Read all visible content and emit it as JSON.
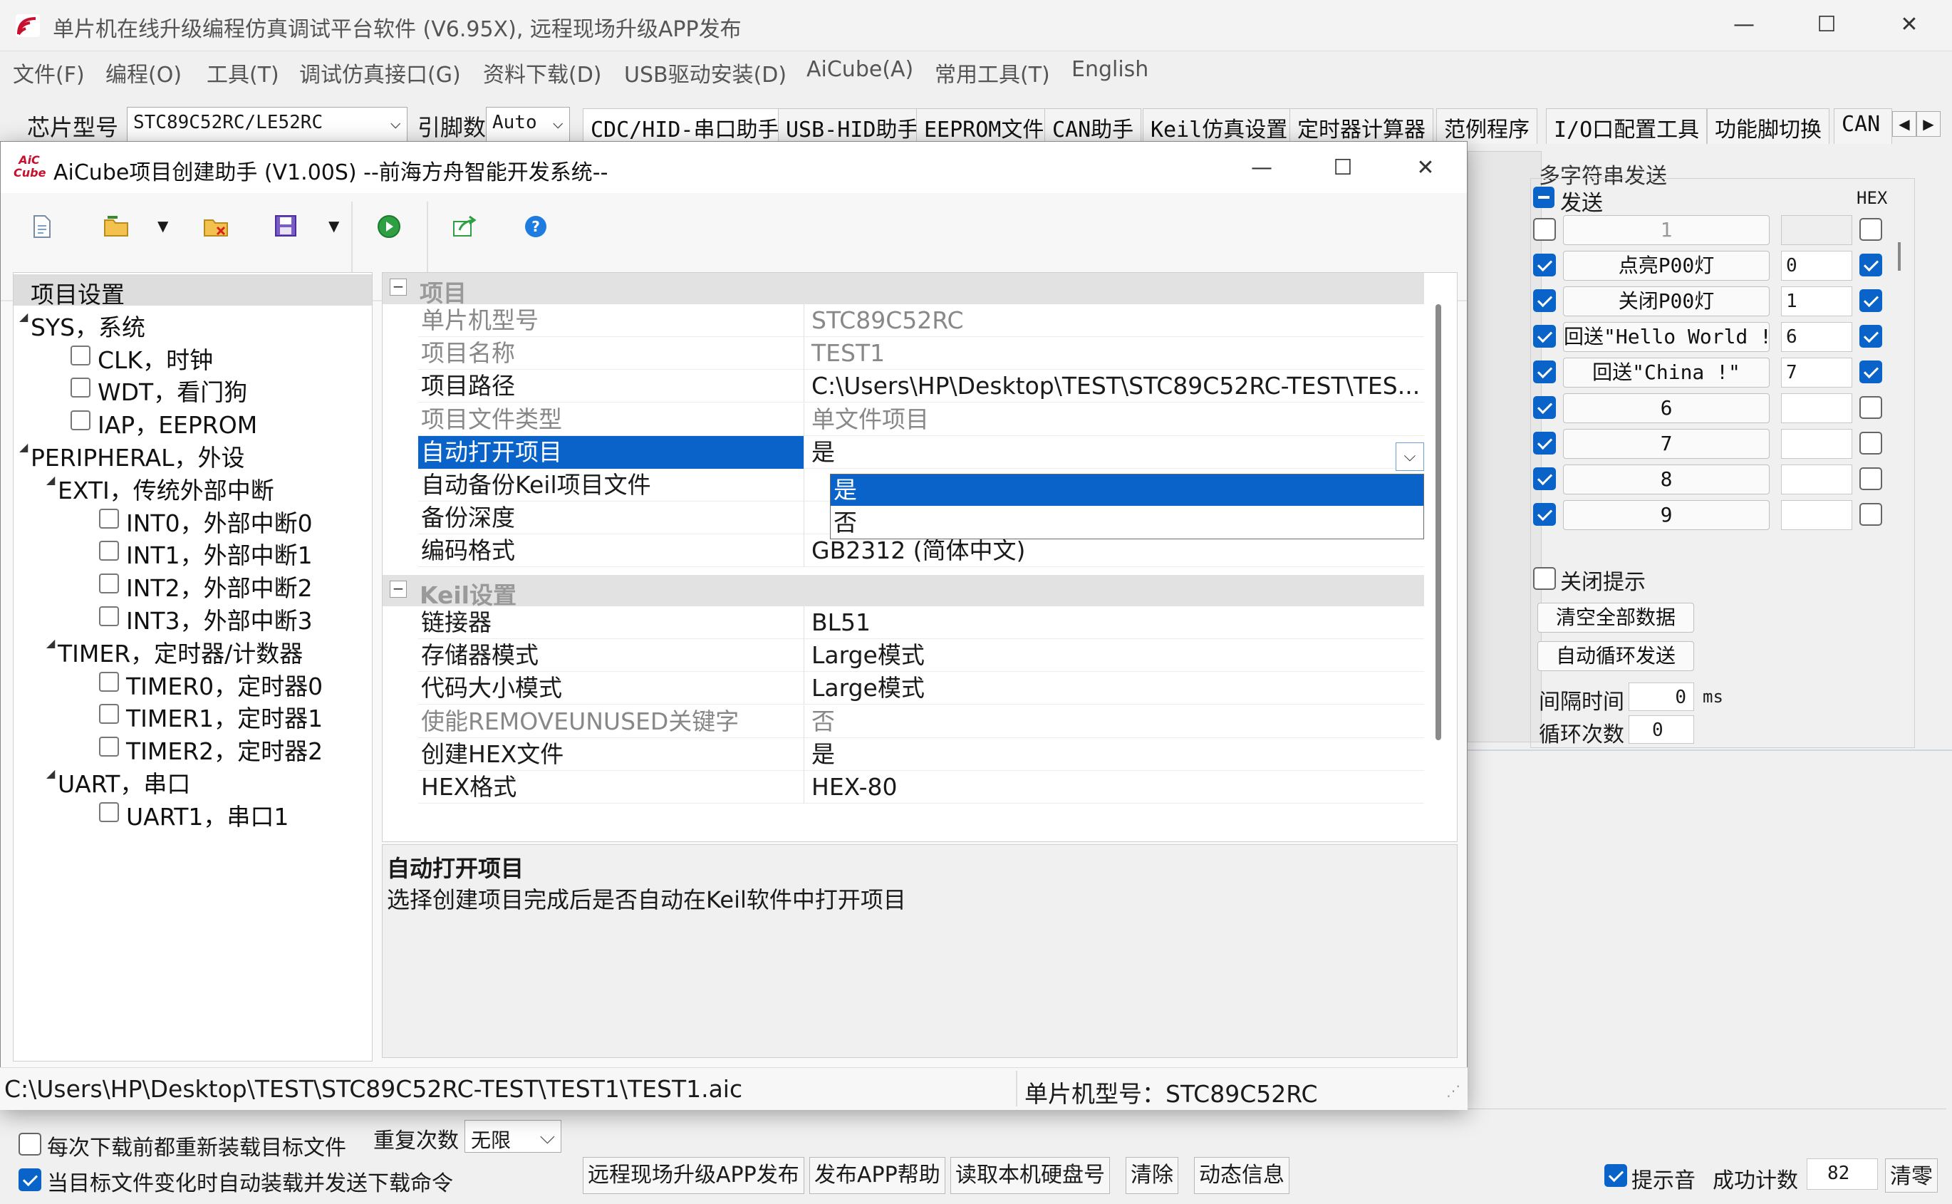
{
  "main_window": {
    "title": "单片机在线升级编程仿真调试平台软件 (V6.95X), 远程现场升级APP发布",
    "minimize": "—",
    "maximize": "☐",
    "close": "✕"
  },
  "menu": [
    "文件(F)",
    "编程(O)",
    "工具(T)",
    "调试仿真接口(G)",
    "资料下载(D)",
    "USB驱动安装(D)",
    "AiCube(A)",
    "常用工具(T)",
    "English"
  ],
  "toolbar": {
    "chip_label": "芯片型号",
    "chip_value": "STC89C52RC/LE52RC",
    "pin_label": "引脚数",
    "pin_value": "Auto"
  },
  "tabs": [
    "CDC/HID-串口助手",
    "USB-HID助手",
    "EEPROM文件",
    "CAN助手",
    "Keil仿真设置",
    "定时器计算器",
    "范例程序",
    "I/O口配置工具",
    "功能脚切换",
    "CAN"
  ],
  "multi_send": {
    "group_title": "多字符串发送",
    "send_label": "发送",
    "hex_label": "HEX",
    "rows": [
      {
        "checked": false,
        "label": "1",
        "value": "",
        "hex": false
      },
      {
        "checked": true,
        "label": "点亮P00灯",
        "value": "0",
        "hex": true
      },
      {
        "checked": true,
        "label": "关闭P00灯",
        "value": "1",
        "hex": true
      },
      {
        "checked": true,
        "label": "回送\"Hello World !\"",
        "value": "6",
        "hex": true
      },
      {
        "checked": true,
        "label": "回送\"China !\"",
        "value": "7",
        "hex": true
      },
      {
        "checked": true,
        "label": "6",
        "value": "",
        "hex": false
      },
      {
        "checked": true,
        "label": "7",
        "value": "",
        "hex": false
      },
      {
        "checked": true,
        "label": "8",
        "value": "",
        "hex": false
      },
      {
        "checked": true,
        "label": "9",
        "value": "",
        "hex": false
      }
    ],
    "close_tip": "关闭提示",
    "clear_all": "清空全部数据",
    "auto_loop": "自动循环发送",
    "interval_label": "间隔时间",
    "interval_value": "0",
    "interval_unit": "ms",
    "loop_label": "循环次数",
    "loop_value": "0"
  },
  "dialog": {
    "logo": "AiC Cube",
    "title": "AiCube项目创建助手 (V1.00S) --前海方舟智能开发系统--",
    "tree": [
      {
        "label": "项目设置",
        "level": 0,
        "selected": true,
        "checkbox": false,
        "arrow": false
      },
      {
        "label": "SYS，系统",
        "level": 0,
        "selected": false,
        "checkbox": false,
        "arrow": true
      },
      {
        "label": "CLK，时钟",
        "level": 1,
        "checkbox": true
      },
      {
        "label": "WDT，看门狗",
        "level": 1,
        "checkbox": true
      },
      {
        "label": "IAP，EEPROM",
        "level": 1,
        "checkbox": true
      },
      {
        "label": "PERIPHERAL，外设",
        "level": 0,
        "checkbox": false,
        "arrow": true
      },
      {
        "label": "EXTI，传统外部中断",
        "level": 1,
        "checkbox": false,
        "arrow": true
      },
      {
        "label": "INT0，外部中断0",
        "level": 2,
        "checkbox": true
      },
      {
        "label": "INT1，外部中断1",
        "level": 2,
        "checkbox": true
      },
      {
        "label": "INT2，外部中断2",
        "level": 2,
        "checkbox": true
      },
      {
        "label": "INT3，外部中断3",
        "level": 2,
        "checkbox": true
      },
      {
        "label": "TIMER，定时器/计数器",
        "level": 1,
        "checkbox": false,
        "arrow": true
      },
      {
        "label": "TIMER0，定时器0",
        "level": 2,
        "checkbox": true
      },
      {
        "label": "TIMER1，定时器1",
        "level": 2,
        "checkbox": true
      },
      {
        "label": "TIMER2，定时器2",
        "level": 2,
        "checkbox": true
      },
      {
        "label": "UART，串口",
        "level": 1,
        "checkbox": false,
        "arrow": true
      },
      {
        "label": "UART1，串口1",
        "level": 2,
        "checkbox": true
      }
    ],
    "grid": {
      "cat_project": "项目",
      "cat_keil": "Keil设置",
      "rows": [
        {
          "name": "单片机型号",
          "value": "STC89C52RC",
          "grey": true
        },
        {
          "name": "项目名称",
          "value": "TEST1",
          "grey": true
        },
        {
          "name": "项目路径",
          "value": "C:\\Users\\HP\\Desktop\\TEST\\STC89C52RC-TEST\\TES...",
          "grey": false
        },
        {
          "name": "项目文件类型",
          "value": "单文件项目",
          "grey": true
        },
        {
          "name": "自动打开项目",
          "value": "是",
          "grey": false,
          "selected": true
        },
        {
          "name": "自动备份Keil项目文件",
          "value": "",
          "grey": false
        },
        {
          "name": "备份深度",
          "value": "",
          "grey": false
        },
        {
          "name": "编码格式",
          "value": "GB2312 (简体中文)",
          "grey": false
        }
      ],
      "keil_rows": [
        {
          "name": "链接器",
          "value": "BL51",
          "grey": false
        },
        {
          "name": "存储器模式",
          "value": "Large模式",
          "grey": false
        },
        {
          "name": "代码大小模式",
          "value": "Large模式",
          "grey": false
        },
        {
          "name": "使能REMOVEUNUSED关键字",
          "value": "否",
          "grey": true
        },
        {
          "name": "创建HEX文件",
          "value": "是",
          "grey": false
        },
        {
          "name": "HEX格式",
          "value": "HEX-80",
          "grey": false
        }
      ],
      "dropdown_options": [
        "是",
        "否"
      ]
    },
    "desc_title": "自动打开项目",
    "desc_text": "选择创建项目完成后是否自动在Keil软件中打开项目",
    "status_path": "C:\\Users\\HP\\Desktop\\TEST\\STC89C52RC-TEST\\TEST1\\TEST1.aic",
    "status_chip": "单片机型号：STC89C52RC"
  },
  "bottom": {
    "reload_label": "每次下载前都重新装载目标文件",
    "auto_send_label": "当目标文件变化时自动装载并发送下载命令",
    "retry_label": "重复次数",
    "retry_value": "无限",
    "buttons": [
      "远程现场升级APP发布",
      "发布APP帮助",
      "读取本机硬盘号",
      "清除",
      "动态信息"
    ],
    "sound_label": "提示音",
    "success_label": "成功计数",
    "success_value": "82",
    "clear_zero": "清零"
  }
}
